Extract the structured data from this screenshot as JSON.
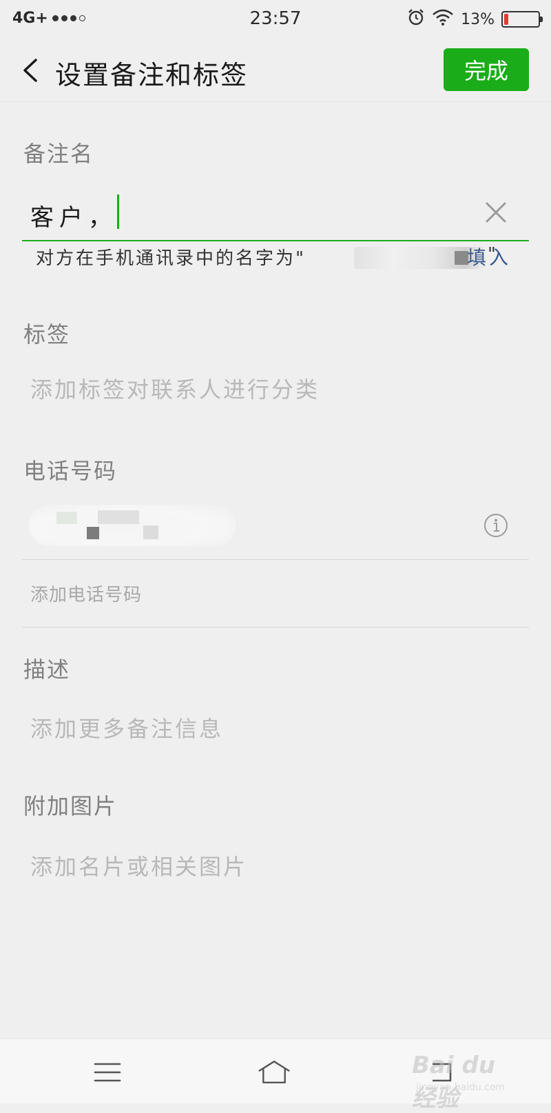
{
  "status_bar": {
    "network": "4G+",
    "time": "23:57",
    "battery_percent": "13%",
    "battery_level": 0.13,
    "icons": [
      "alarm-icon",
      "wifi-icon",
      "battery-icon"
    ]
  },
  "header": {
    "title": "设置备注和标签",
    "done_label": "完成",
    "accent_color": "#1aad19"
  },
  "remark": {
    "label": "备注名",
    "value": "客户，",
    "hint_prefix": "对方在手机通讯录中的名字为\"",
    "hint_suffix": "\"",
    "fill_label": "填入"
  },
  "tags": {
    "label": "标签",
    "placeholder": "添加标签对联系人进行分类"
  },
  "phone": {
    "label": "电话号码",
    "add_label": "添加电话号码"
  },
  "description": {
    "label": "描述",
    "placeholder": "添加更多备注信息"
  },
  "attachment": {
    "label": "附加图片",
    "placeholder": "添加名片或相关图片"
  },
  "watermark": {
    "text": "Bai du 经验",
    "sub": "jingyan.baidu.com"
  }
}
